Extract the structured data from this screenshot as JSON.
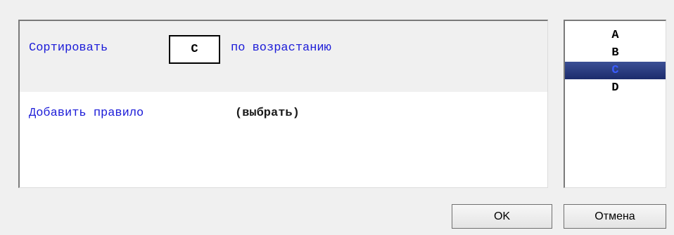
{
  "rules": {
    "sort_prefix": "Сортировать",
    "sort_key": "C",
    "sort_suffix": "по возрастанию",
    "add_rule_label": "Добавить правило",
    "add_rule_choose": "(выбрать)"
  },
  "letter_list": {
    "items": [
      {
        "label": "A",
        "selected": false
      },
      {
        "label": "B",
        "selected": false
      },
      {
        "label": "C",
        "selected": true
      },
      {
        "label": "D",
        "selected": false
      }
    ]
  },
  "buttons": {
    "ok_label": "OK",
    "cancel_label": "Отмена"
  },
  "colors": {
    "link_text": "#1c1cd8",
    "selection_bg": "#1c2c6c",
    "selection_text": "#3a5cff",
    "window_bg": "#f0f0f0"
  }
}
